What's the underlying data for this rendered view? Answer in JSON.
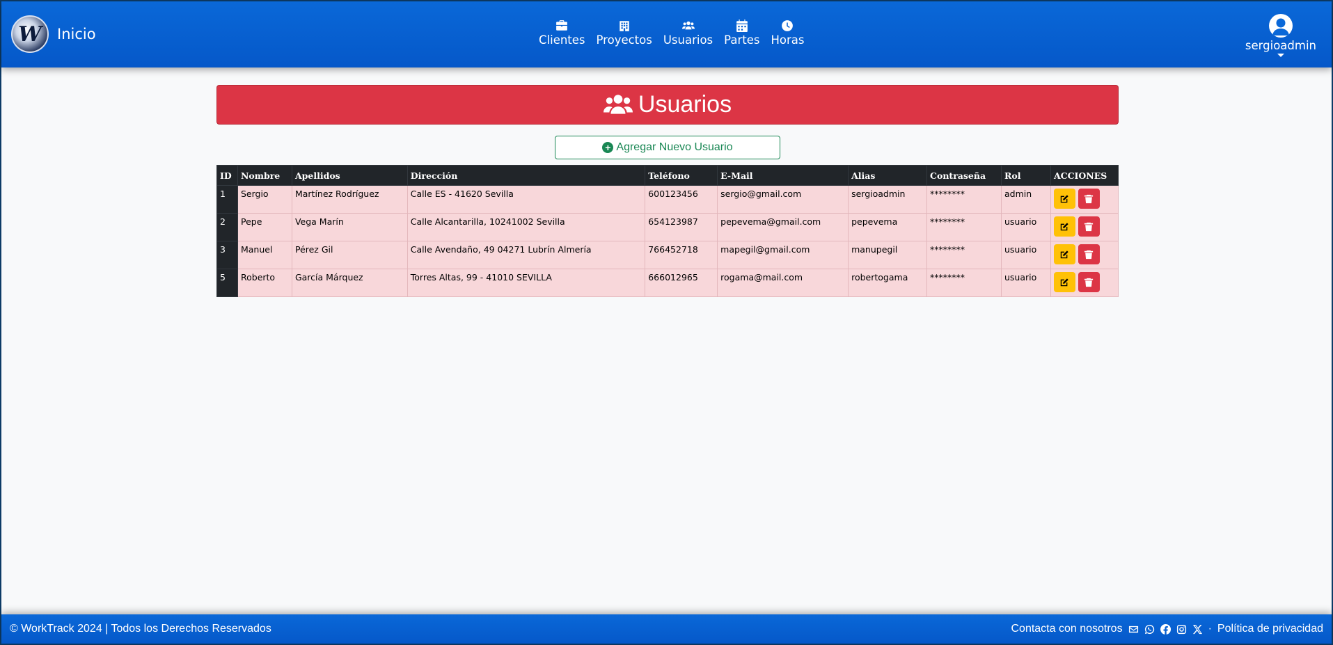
{
  "brand": {
    "logo_letter": "W",
    "home_label": "Inicio"
  },
  "nav": {
    "items": [
      {
        "label": "Clientes",
        "icon": "briefcase-icon"
      },
      {
        "label": "Proyectos",
        "icon": "building-icon"
      },
      {
        "label": "Usuarios",
        "icon": "users-icon"
      },
      {
        "label": "Partes",
        "icon": "calendar-icon"
      },
      {
        "label": "Horas",
        "icon": "clock-icon"
      }
    ]
  },
  "user": {
    "name": "sergioadmin"
  },
  "page": {
    "title": "Usuarios",
    "add_button_label": "Agregar Nuevo Usuario"
  },
  "table": {
    "headers": [
      "ID",
      "Nombre",
      "Apellidos",
      "Dirección",
      "Teléfono",
      "E-Mail",
      "Alias",
      "Contraseña",
      "Rol",
      "ACCIONES"
    ],
    "rows": [
      [
        "1",
        "Sergio",
        "Martínez Rodríguez",
        "Calle ES - 41620 Sevilla",
        "600123456",
        "sergio@gmail.com",
        "sergioadmin",
        "********",
        "admin"
      ],
      [
        "2",
        "Pepe",
        "Vega Marín",
        "Calle Alcantarilla, 10241002 Sevilla",
        "654123987",
        "pepevema@gmail.com",
        "pepevema",
        "********",
        "usuario"
      ],
      [
        "3",
        "Manuel",
        "Pérez Gil",
        "Calle Avendaño, 49 04271 Lubrín Almería",
        "766452718",
        "mapegil@gmail.com",
        "manupegil",
        "********",
        "usuario"
      ],
      [
        "5",
        "Roberto",
        "García Márquez",
        "Torres Altas, 99 - 41010 SEVILLA",
        "666012965",
        "rogama@mail.com",
        "robertogama",
        "********",
        "usuario"
      ]
    ]
  },
  "footer": {
    "copyright": "© WorkTrack 2024 | Todos los Derechos Reservados",
    "contact_label": "Contacta con nosotros",
    "separator": "·",
    "privacy_label": "Política de privacidad",
    "social_icons": [
      "envelope-icon",
      "whatsapp-icon",
      "facebook-icon",
      "instagram-icon",
      "x-icon"
    ]
  },
  "colors": {
    "navbar": "#0a68d8",
    "title_bar": "#dc3545",
    "add_button": "#198754",
    "table_header": "#212529",
    "row_bg": "#f8d7da",
    "edit_button": "#ffc107",
    "delete_button": "#dc3545"
  }
}
